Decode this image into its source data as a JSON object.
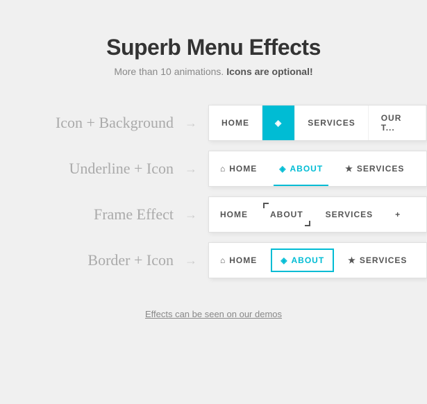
{
  "header": {
    "title": "Superb Menu Effects",
    "subtitle_plain": "More than 10 animations. ",
    "subtitle_emphasis": "Icons are optional!"
  },
  "effects": [
    {
      "label": "Icon + Background",
      "id": "icon-background",
      "items": [
        {
          "text": "HOME",
          "active": false,
          "icon": null
        },
        {
          "text": "",
          "active": true,
          "icon": "diamond"
        },
        {
          "text": "SERVICES",
          "active": false,
          "icon": null
        },
        {
          "text": "OUR T...",
          "active": false,
          "icon": null
        }
      ]
    },
    {
      "label": "Underline + Icon",
      "id": "underline-icon",
      "items": [
        {
          "text": "HOME",
          "active": false,
          "icon": "home"
        },
        {
          "text": "ABOUT",
          "active": true,
          "icon": "diamond"
        },
        {
          "text": "SERVICES",
          "active": false,
          "icon": "star"
        }
      ]
    },
    {
      "label": "Frame Effect",
      "id": "frame-effect",
      "items": [
        {
          "text": "HOME",
          "active": false,
          "icon": null
        },
        {
          "text": "ABOUT",
          "active": true,
          "icon": null
        },
        {
          "text": "SERVICES",
          "active": false,
          "icon": null
        }
      ]
    },
    {
      "label": "Border + Icon",
      "id": "border-icon",
      "items": [
        {
          "text": "HOME",
          "active": false,
          "icon": "home"
        },
        {
          "text": "ABOUT",
          "active": true,
          "icon": "diamond"
        },
        {
          "text": "SERVICES",
          "active": false,
          "icon": "star"
        }
      ]
    }
  ],
  "demo_link": "Effects can be seen on our demos",
  "arrow_symbol": "→"
}
